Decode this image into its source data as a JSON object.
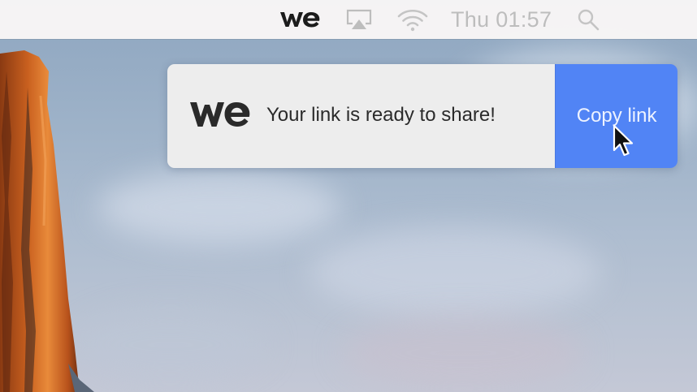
{
  "menubar": {
    "app_icon": "wetransfer-logo-icon",
    "airplay_icon": "airplay-icon",
    "wifi_icon": "wifi-icon",
    "clock": "Thu 01:57",
    "search_icon": "spotlight-search-icon"
  },
  "notification": {
    "logo_icon": "wetransfer-logo-icon",
    "message": "Your link is ready to share!",
    "action_label": "Copy link",
    "action_color": "#5184f5",
    "body_color": "#ededed"
  },
  "desktop": {
    "wallpaper": "mountain-cliff-sky-wallpaper"
  },
  "cursor": {
    "icon": "arrow-cursor-icon"
  }
}
